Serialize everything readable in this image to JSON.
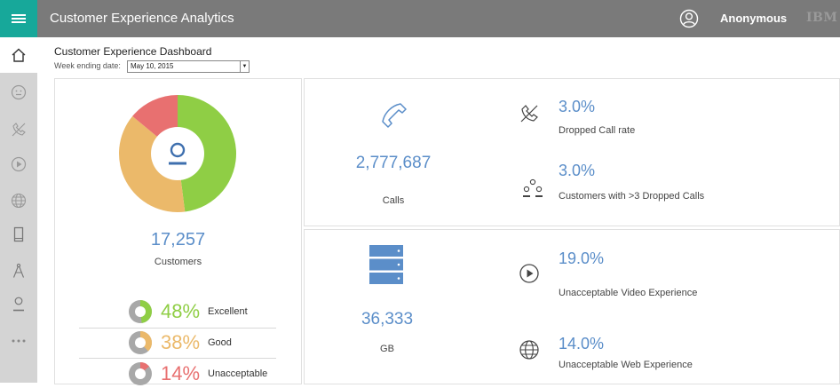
{
  "header": {
    "app_title": "Customer Experience Analytics",
    "user_name": "Anonymous",
    "brand": "IBM"
  },
  "sidebar": {
    "items": [
      {
        "icon": "home-icon"
      },
      {
        "icon": "smiley-icon"
      },
      {
        "icon": "dropped-call-icon"
      },
      {
        "icon": "play-icon"
      },
      {
        "icon": "globe-icon"
      },
      {
        "icon": "mobile-icon"
      },
      {
        "icon": "compass-icon"
      },
      {
        "icon": "person-icon"
      },
      {
        "icon": "more-icon"
      }
    ]
  },
  "dashboard": {
    "title": "Customer Experience Dashboard",
    "week_label": "Week ending date:",
    "week_value": "May 10, 2015"
  },
  "customers": {
    "value": "17,257",
    "label": "Customers",
    "donut": [
      {
        "name": "Excellent",
        "fraction": 0.48,
        "color": "#8fce45"
      },
      {
        "name": "Good",
        "fraction": 0.38,
        "color": "#ebb96a"
      },
      {
        "name": "Unacceptable",
        "fraction": 0.14,
        "color": "#e87070"
      }
    ],
    "ratings": [
      {
        "pct": "48%",
        "label": "Excellent",
        "fraction": 0.48,
        "color": "#8fce45"
      },
      {
        "pct": "38%",
        "label": "Good",
        "fraction": 0.38,
        "color": "#ebb96a"
      },
      {
        "pct": "14%",
        "label": "Unacceptable",
        "fraction": 0.14,
        "color": "#e87070"
      }
    ]
  },
  "calls": {
    "value": "2,777,687",
    "label": "Calls",
    "dropped_rate_pct": "3.0%",
    "dropped_rate_label": "Dropped Call rate",
    "multi_drop_pct": "3.0%",
    "multi_drop_label": "Customers with >3 Dropped Calls"
  },
  "data": {
    "value": "36,333",
    "label": "GB",
    "video_pct": "19.0%",
    "video_label": "Unacceptable Video Experience",
    "web_pct": "14.0%",
    "web_label": "Unacceptable Web Experience"
  },
  "colors": {
    "accent": "#17a89a",
    "value_blue": "#5b8ec9",
    "header_gray": "#7a7a7a"
  }
}
